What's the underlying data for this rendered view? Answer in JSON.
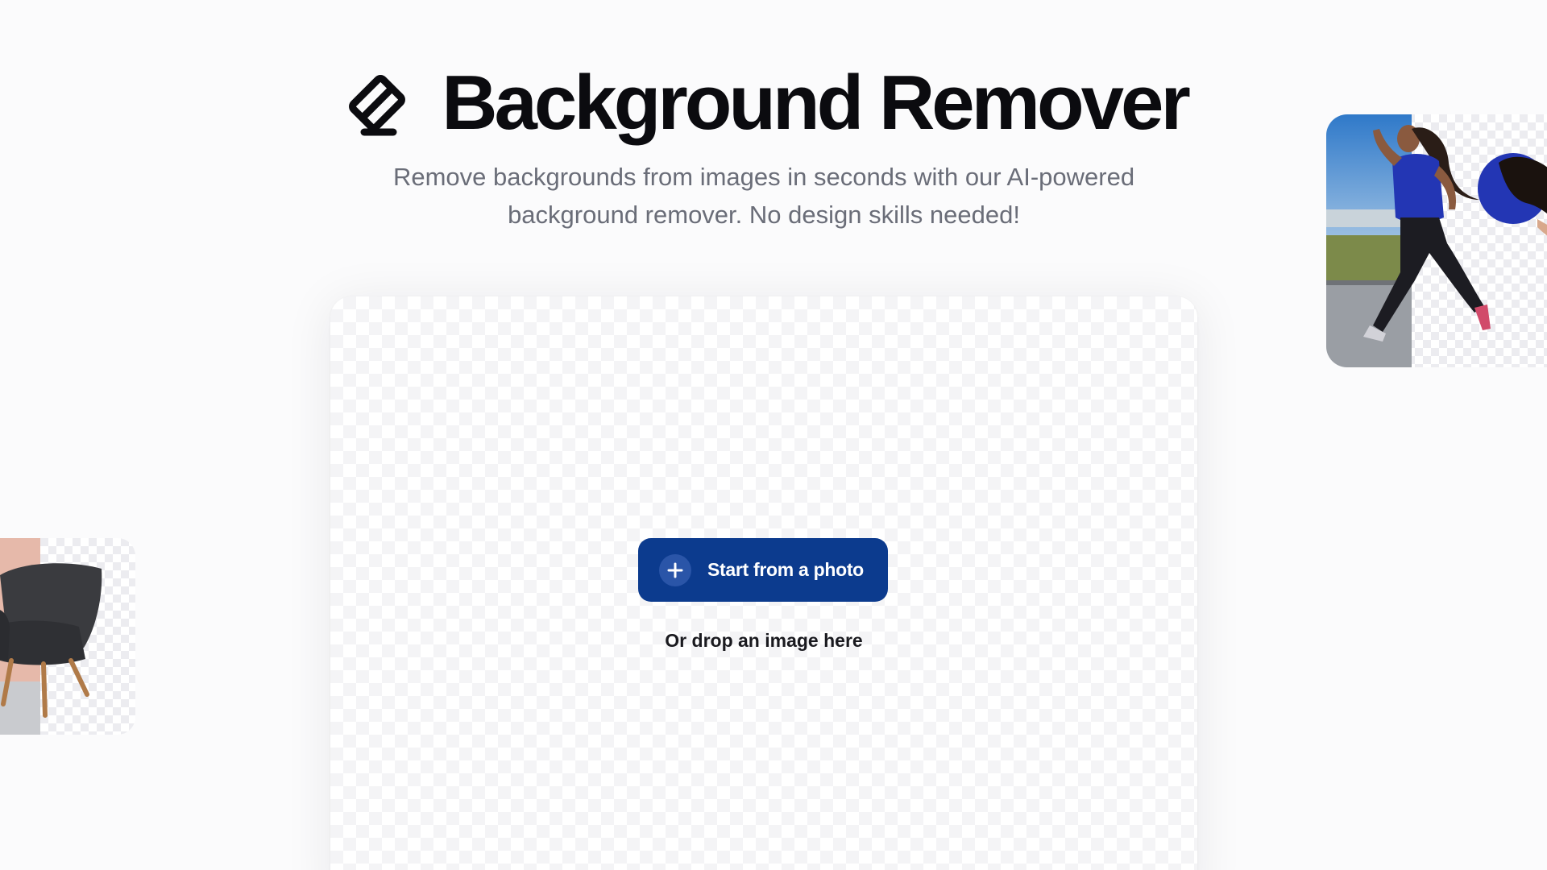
{
  "hero": {
    "title": "Background Remover",
    "subtitle_line1": "Remove backgrounds from images in seconds with our AI-powered",
    "subtitle_line2": "background remover. No design skills needed!",
    "logo_icon": "eraser-icon"
  },
  "upload": {
    "button_label": "Start from a photo",
    "button_icon": "plus-icon",
    "drop_hint": "Or drop an image here"
  },
  "examples": [
    {
      "subject": "girl-running"
    },
    {
      "subject": "armchair"
    }
  ],
  "colors": {
    "page_background": "#fbfbfc",
    "title_text": "#0b0b0f",
    "subtitle_text": "#6a6d78",
    "button_background": "#0c3b8e",
    "button_text": "#ffffff"
  }
}
